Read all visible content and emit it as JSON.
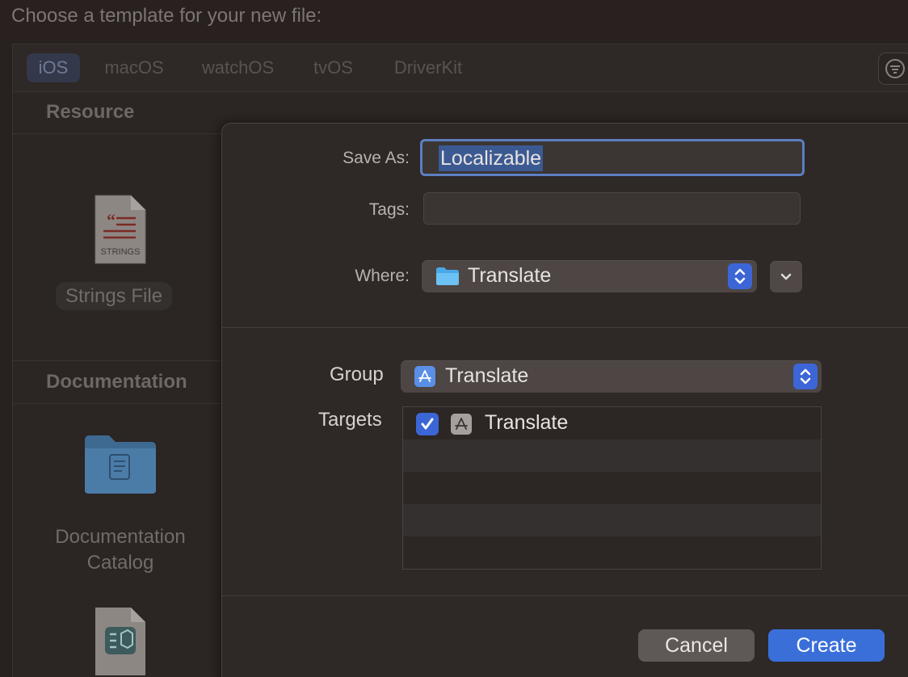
{
  "chooser": {
    "title": "Choose a template for your new file:",
    "platforms": [
      "iOS",
      "macOS",
      "watchOS",
      "tvOS",
      "DriverKit"
    ],
    "selected_platform": "iOS",
    "filter_icon": "filter-circle-icon",
    "sections": [
      {
        "header": "Resource",
        "items": [
          {
            "label": "Strings File",
            "icon_text": "STRINGS",
            "icon": "strings-file-icon"
          }
        ]
      },
      {
        "header": "Documentation",
        "items": [
          {
            "label_line1": "Documentation",
            "label_line2": "Catalog",
            "icon": "folder-icon"
          },
          {
            "icon": "document-file-icon"
          }
        ]
      }
    ]
  },
  "sheet": {
    "save_as_label": "Save As:",
    "save_as_value": "Localizable",
    "tags_label": "Tags:",
    "tags_value": "",
    "where_label": "Where:",
    "where_value": "Translate",
    "group_label": "Group",
    "group_value": "Translate",
    "targets_label": "Targets",
    "targets": [
      {
        "name": "Translate",
        "checked": true
      }
    ],
    "cancel_label": "Cancel",
    "create_label": "Create"
  },
  "colors": {
    "accent": "#3a6fd9",
    "selection": "#3c5a92",
    "sheet_bg": "#2e2826",
    "window_bg": "#28211f"
  }
}
